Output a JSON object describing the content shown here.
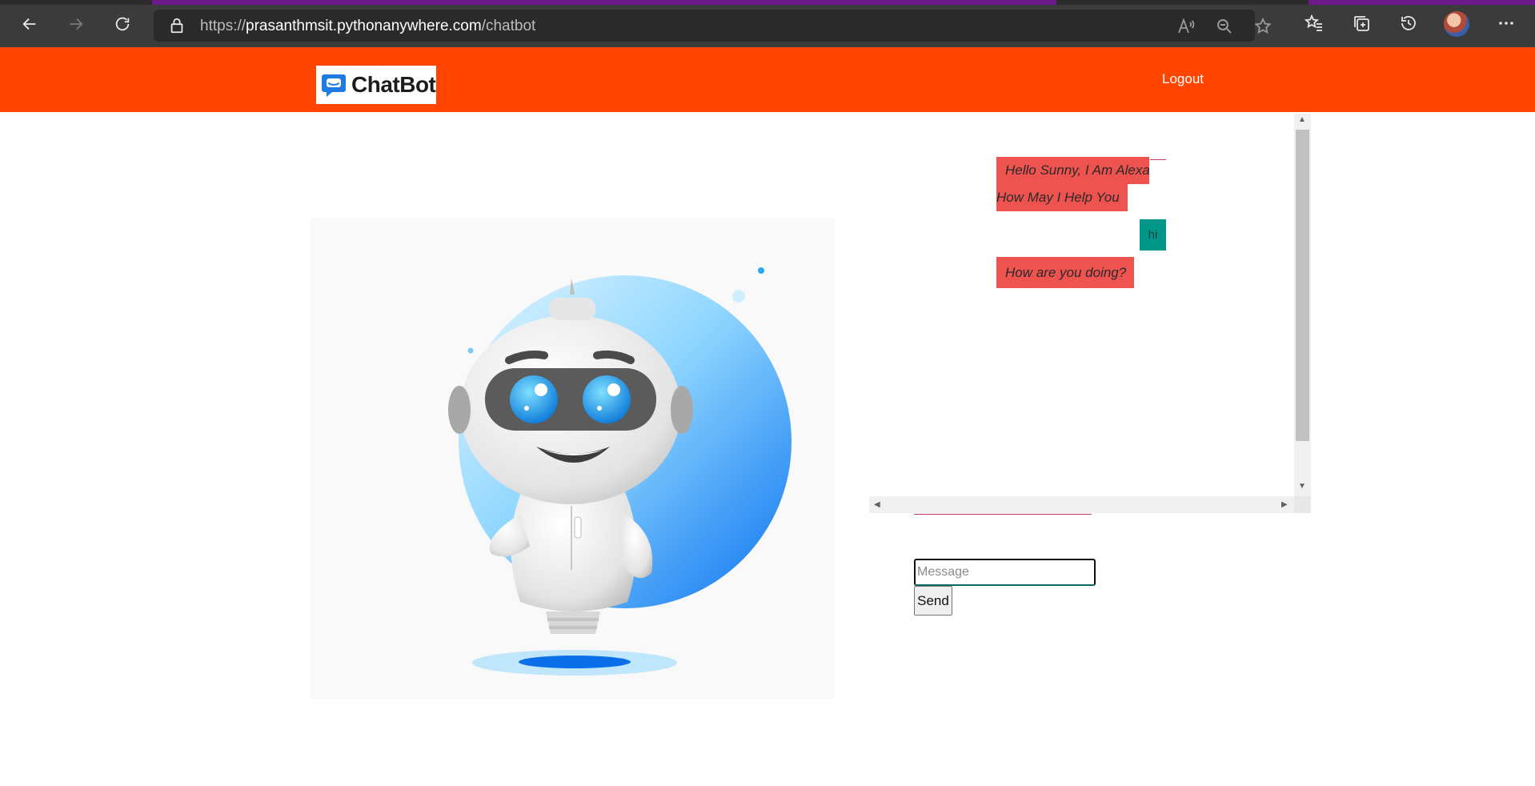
{
  "browser": {
    "url_prefix": "https://",
    "url_host": "prasanthmsit.pythonanywhere.com",
    "url_path": "/chatbot",
    "icons": [
      "back-icon",
      "forward-icon",
      "refresh-icon",
      "lock-icon",
      "read-aloud-icon",
      "zoom-out-icon",
      "add-favorite-icon",
      "favorites-icon",
      "collections-icon",
      "history-icon",
      "profile-avatar",
      "more-icon"
    ]
  },
  "header": {
    "logo_text": "ChatBot",
    "logout_label": "Logout",
    "background_color": "#ff4500"
  },
  "hero": {
    "image": "robot-illustration"
  },
  "chat": {
    "messages": [
      {
        "sender": "bot",
        "line1": "Hello Sunny, I Am Alexa",
        "line2": "How May I Help You"
      },
      {
        "sender": "user",
        "text": "hi"
      },
      {
        "sender": "bot",
        "text": "How are you doing?"
      }
    ],
    "bot_color": "#ef5350",
    "user_color": "#009688"
  },
  "composer": {
    "placeholder": "Message",
    "value": "",
    "send_label": "Send"
  }
}
